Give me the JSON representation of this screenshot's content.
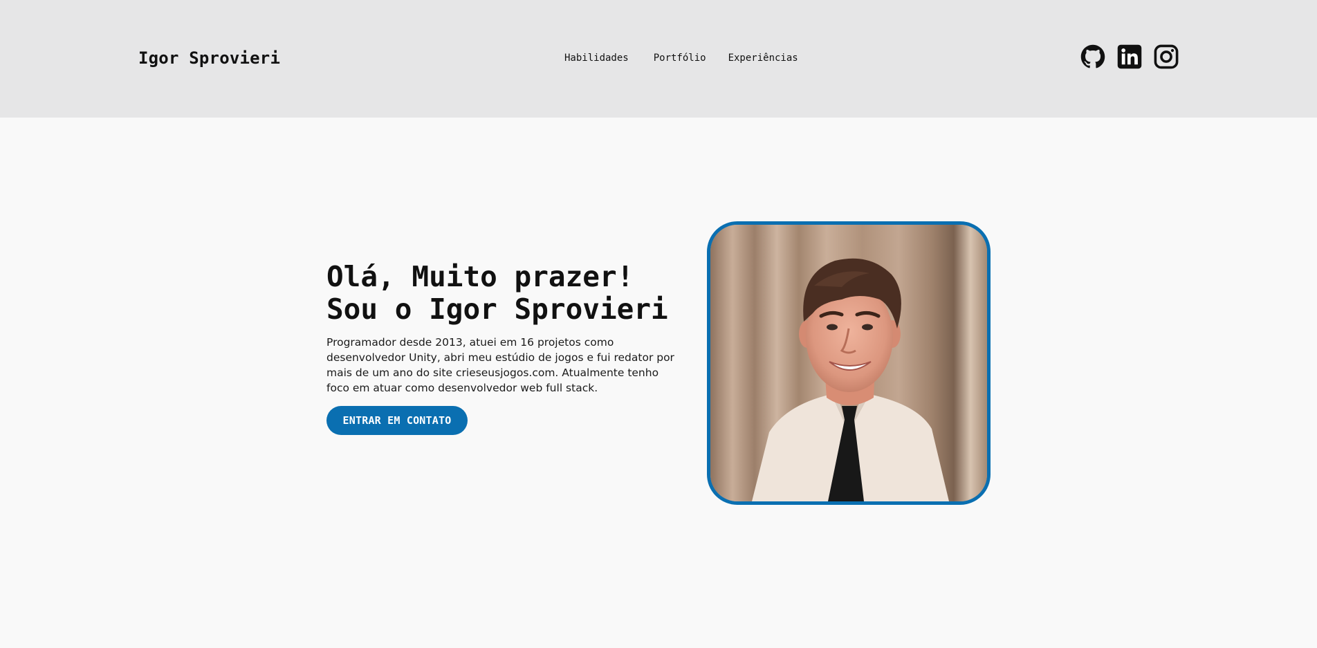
{
  "header": {
    "brand": "Igor Sprovieri",
    "nav": [
      {
        "label": "Habilidades"
      },
      {
        "label": "Portfólio"
      },
      {
        "label": "Experiências"
      }
    ],
    "social": [
      {
        "icon": "github-icon"
      },
      {
        "icon": "linkedin-icon"
      },
      {
        "icon": "instagram-icon"
      }
    ]
  },
  "hero": {
    "title_line1": "Olá, Muito prazer!",
    "title_line2": "Sou o Igor Sprovieri",
    "description": "Programador desde 2013, atuei em 16 projetos como desenvolvedor Unity, abri meu estúdio de jogos e fui redator por mais de um ano do site crieseusjogos.com. Atualmente tenho foco em atuar como desenvolvedor web full stack.",
    "cta_label": "ENTRAR EM CONTATO"
  },
  "colors": {
    "header_bg": "#e6e6e7",
    "page_bg": "#f9f9f9",
    "accent": "#0a6fb1",
    "text": "#111111"
  }
}
